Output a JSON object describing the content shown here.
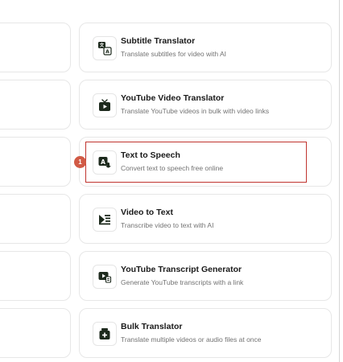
{
  "tools": [
    {
      "title": "Subtitle Translator",
      "description": "Translate subtitles for video with AI",
      "icon": "subtitle-translate-icon"
    },
    {
      "title": "YouTube Video Translator",
      "description": "Translate YouTube videos in bulk with video links",
      "icon": "youtube-tv-icon"
    },
    {
      "title": "Text to Speech",
      "description": "Convert text to speech free online",
      "icon": "text-to-speech-icon"
    },
    {
      "title": "Video to Text",
      "description": "Transcribe video to text with AI",
      "icon": "video-to-text-icon"
    },
    {
      "title": "YouTube Transcript Generator",
      "description": "Generate YouTube transcripts with a link",
      "icon": "youtube-transcript-icon"
    },
    {
      "title": "Bulk Translator",
      "description": "Translate multiple videos or audio files at once",
      "icon": "bulk-translate-icon"
    }
  ],
  "annotation": {
    "marker_label": "1",
    "highlighted_tool": "Text to Speech"
  },
  "colors": {
    "highlight": "#c0342f",
    "marker": "#d15a45",
    "icon": "#1d2a1d"
  }
}
